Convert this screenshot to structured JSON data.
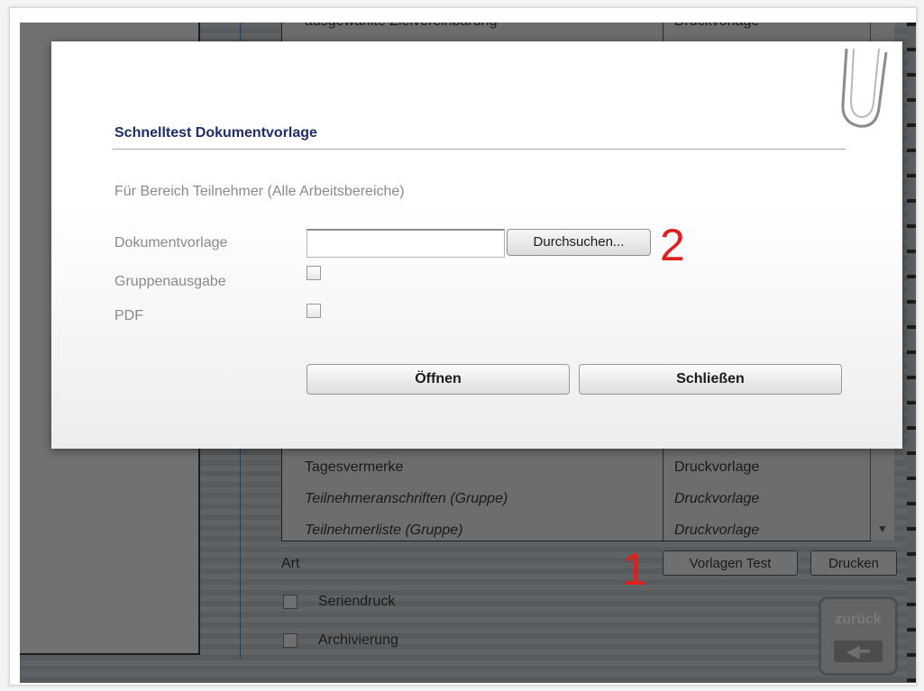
{
  "background_list": {
    "rows": [
      {
        "name": "ausgewählte Zielvereinbarung",
        "type": "Druckvorlage",
        "italic": false
      },
      {
        "name": "Tagesvermerke",
        "type": "Druckvorlage",
        "italic": false
      },
      {
        "name": "Teilnehmeranschriften (Gruppe)",
        "type": "Druckvorlage",
        "italic": true
      },
      {
        "name": "Teilnehmerliste (Gruppe)",
        "type": "Druckvorlage",
        "italic": true
      }
    ],
    "scroll_down_glyph": "▼"
  },
  "bottom_controls": {
    "art_label": "Art",
    "vorlagen_test_label": "Vorlagen Test",
    "drucken_label": "Drucken",
    "seriendruck_label": "Seriendruck",
    "archivierung_label": "Archivierung",
    "zurueck_label": "zurück",
    "zurueck_arrow": "◀━"
  },
  "dialog": {
    "title": "Schnelltest Dokumentvorlage",
    "subtitle": "Für Bereich Teilnehmer (Alle Arbeitsbereiche)",
    "fields": {
      "dokumentvorlage_label": "Dokumentvorlage",
      "dokumentvorlage_value": "",
      "browse_label": "Durchsuchen...",
      "gruppenausgabe_label": "Gruppenausgabe",
      "gruppenausgabe_checked": false,
      "pdf_label": "PDF",
      "pdf_checked": false
    },
    "buttons": {
      "open_label": "Öffnen",
      "close_label": "Schließen"
    }
  },
  "annotations": {
    "marker_1": "1",
    "marker_2": "2",
    "color": "#e02020"
  },
  "colors": {
    "dialog_title": "#1f2d6b",
    "overlay_background": "#5b5e60"
  }
}
